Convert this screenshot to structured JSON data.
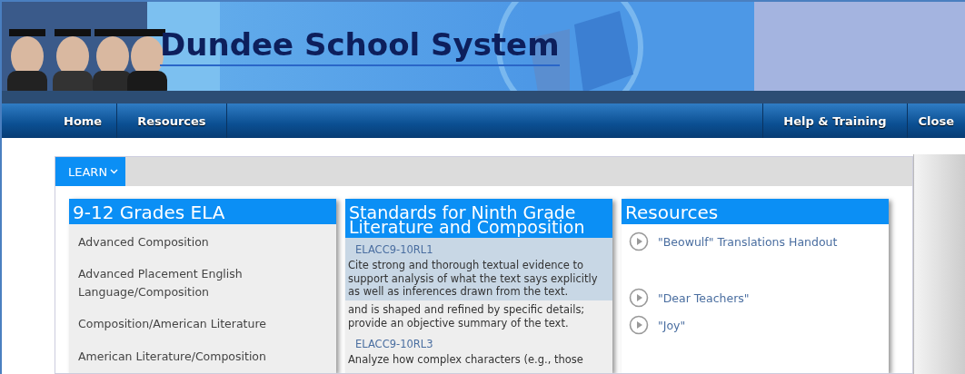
{
  "banner": {
    "title": "Dundee School System"
  },
  "nav": {
    "left": [
      {
        "label": "Home"
      },
      {
        "label": "Resources"
      }
    ],
    "right": [
      {
        "label": "Help & Training"
      },
      {
        "label": "Close"
      }
    ]
  },
  "menu": {
    "label": "LEARN"
  },
  "panels": [
    {
      "kind": "list",
      "title": "9-12 Grades ELA",
      "items": [
        {
          "label": "Advanced Composition"
        },
        {
          "label": "Advanced Placement English Language/Composition"
        },
        {
          "label": "Composition/American Literature"
        },
        {
          "label": "American Literature/Composition"
        }
      ]
    },
    {
      "kind": "standards",
      "title": "Standards for Ninth Grade Literature and Composition",
      "items": [
        {
          "code": "ELACC9-10RL1",
          "text": "Cite strong and thorough textual evidence to support analysis of what the text says explicitly as well as inferences drawn from the text.",
          "selected": true
        },
        {
          "text": "and is shaped and refined by specific details; provide an objective summary of the text.",
          "selected": false
        },
        {
          "code": "ELACC9-10RL3",
          "text": "Analyze how complex characters (e.g., those",
          "selected": false
        }
      ]
    },
    {
      "kind": "resources",
      "title": "Resources",
      "items": [
        {
          "label": "\"Beowulf\" Translations Handout"
        },
        {
          "label": "\"Dear Teachers\""
        },
        {
          "label": "\"Joy\""
        }
      ]
    }
  ]
}
